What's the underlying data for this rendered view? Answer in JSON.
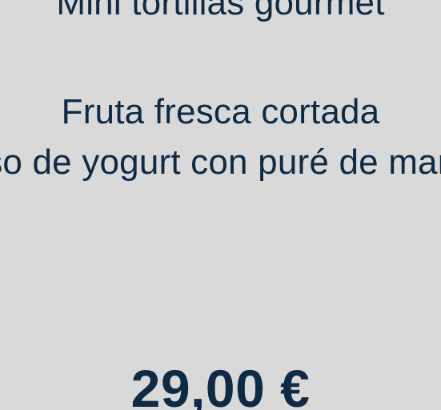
{
  "menu": {
    "items": [
      "Mini tortillas gourmet",
      "Fruta fresca cortada",
      "Vaso de yogurt con puré de mango"
    ],
    "price": "29,00 €"
  }
}
